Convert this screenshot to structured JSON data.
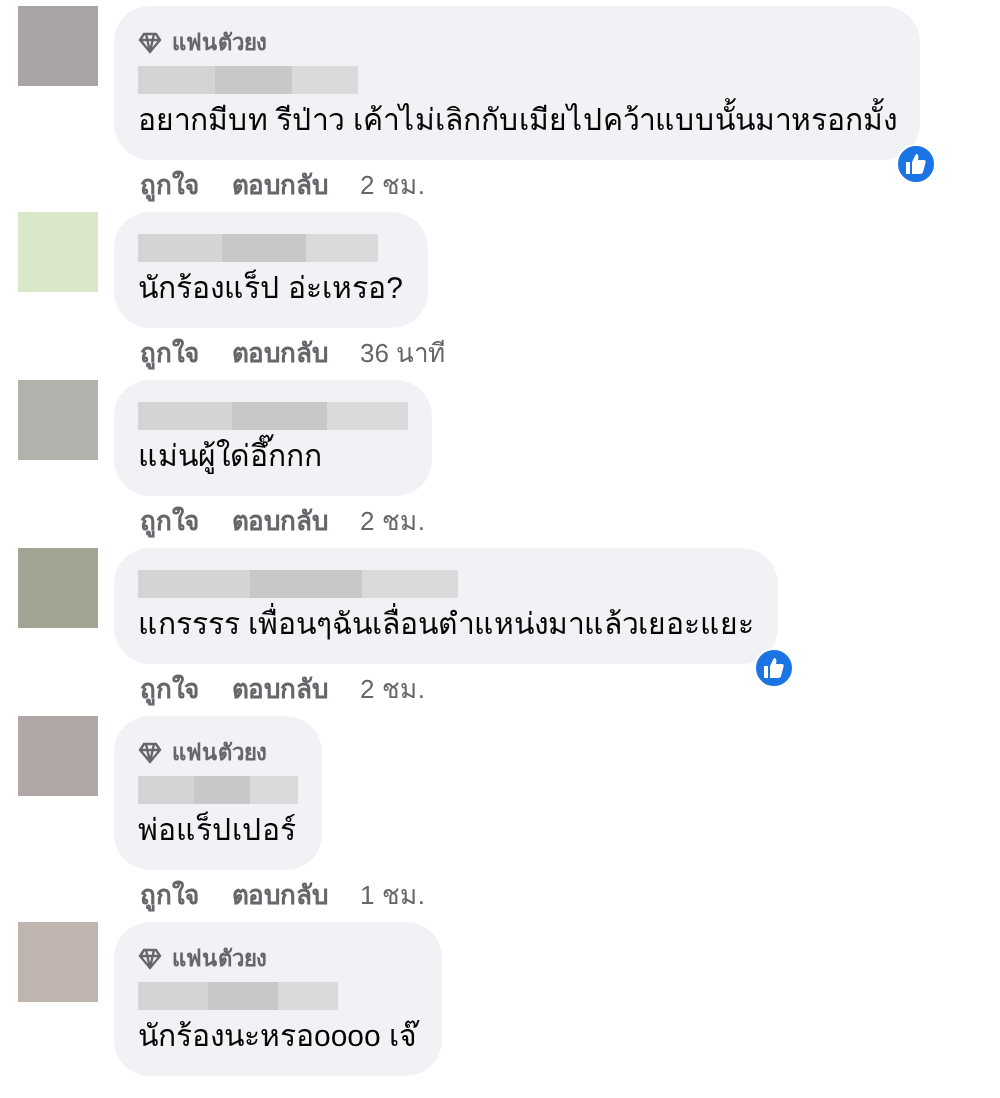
{
  "comments": [
    {
      "color": "#a9a5a5",
      "badge": "แฟนตัวยง",
      "text": "อยากมีบท รีป่าว เค้าไม่เลิกกับเมียไปคว้าแบบนั้นมาหรอกมั้ง",
      "liked": true,
      "actions": [
        "ถูกใจ",
        "ตอบกลับ",
        "2 ชม."
      ]
    },
    {
      "color": "#d9e8c8",
      "text": "นักร้องแร็ป อ่ะเหรอ?",
      "liked": false,
      "actions": [
        "ถูกใจ",
        "ตอบกลับ",
        "36 นาที"
      ]
    },
    {
      "color": "#b3b1ac",
      "text": "แม่นผู้ใด่อึ๊กกก",
      "liked": false,
      "actions": [
        "ถูกใจ",
        "ตอบกลับ",
        "2 ชม."
      ]
    },
    {
      "color": "#a4a495",
      "text": "แกรรรร เพื่อนๆฉันเลื่อนตำแหน่งมาแล้วเยอะแยะ",
      "liked": true,
      "actions": [
        "ถูกใจ",
        "ตอบกลับ",
        "2 ชม."
      ]
    },
    {
      "color": "#b0a8a6",
      "badge": "แฟนตัวยง",
      "text": "พ่อแร็ปเปอร์",
      "liked": false,
      "actions": [
        "ถูกใจ",
        "ตอบกลับ",
        "1 ชม."
      ]
    },
    {
      "color": "#c0b5ae",
      "badge": "แฟนตัวยง",
      "text": "นักร้องนะหรอoooo เจ๊",
      "liked": false
    }
  ]
}
